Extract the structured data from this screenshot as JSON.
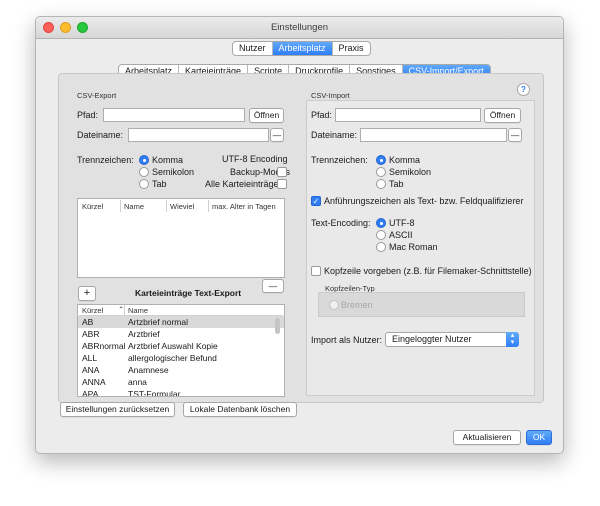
{
  "window": {
    "title": "Einstellungen"
  },
  "main_tabs": [
    {
      "label": "Nutzer"
    },
    {
      "label": "Arbeitsplatz",
      "selected": true
    },
    {
      "label": "Praxis"
    }
  ],
  "sub_tabs": [
    {
      "label": "Arbeitsplatz"
    },
    {
      "label": "Karteieinträge"
    },
    {
      "label": "Scripte"
    },
    {
      "label": "Druckprofile"
    },
    {
      "label": "Sonstiges"
    },
    {
      "label": "CSV-Import/Export",
      "selected": true
    }
  ],
  "help_button": "?",
  "export": {
    "section_title": "CSV-Export",
    "path_label": "Pfad:",
    "path_value": "",
    "open_button": "Öffnen",
    "filename_label": "Dateiname:",
    "filename_value": "",
    "filename_minus": "—",
    "separator_label": "Trennzeichen:",
    "separators": [
      {
        "label": "Komma",
        "checked": true
      },
      {
        "label": "Semikolon",
        "checked": false
      },
      {
        "label": "Tab",
        "checked": false
      }
    ],
    "encoding_label": "UTF-8 Encoding",
    "backup_label": "Backup-Modus",
    "all_entries_label": "Alle Karteieinträge",
    "table_headers": [
      "Kürzel",
      "Name",
      "Wieviel",
      "max. Alter in Tagen"
    ],
    "minus_button": "—",
    "plus_button": "+",
    "list_title": "Karteieinträge Text-Export",
    "list_headers": [
      "Kürzel",
      "Name"
    ],
    "list_rows": [
      {
        "code": "AB",
        "name": "Artzbrief normal"
      },
      {
        "code": "ABR",
        "name": "Arztbrief"
      },
      {
        "code": "ABRnormal",
        "name": "Arztbrief Auswahl Kopie"
      },
      {
        "code": "ALL",
        "name": "allergologischer Befund"
      },
      {
        "code": "ANA",
        "name": "Anamnese"
      },
      {
        "code": "ANNA",
        "name": "anna"
      },
      {
        "code": "APA",
        "name": "TST-Formular"
      }
    ]
  },
  "import": {
    "section_title": "CSV-Import",
    "path_label": "Pfad:",
    "path_value": "",
    "open_button": "Öffnen",
    "filename_label": "Dateiname:",
    "filename_value": "",
    "filename_minus": "—",
    "separator_label": "Trennzeichen:",
    "separators": [
      {
        "label": "Komma",
        "checked": true
      },
      {
        "label": "Semikolon",
        "checked": false
      },
      {
        "label": "Tab",
        "checked": false
      }
    ],
    "quote_label": "Anführungszeichen als Text- bzw. Feldqualifizierer",
    "quote_checked": true,
    "encoding_label": "Text-Encoding:",
    "encodings": [
      {
        "label": "UTF-8",
        "checked": true
      },
      {
        "label": "ASCII",
        "checked": false
      },
      {
        "label": "Mac Roman",
        "checked": false
      }
    ],
    "header_label": "Kopfzeile vorgeben (z.B. für Filemaker-Schnittstelle)",
    "header_checked": false,
    "header_type_label": "Kopfzeilen-Typ",
    "header_type_option": "Bremen",
    "import_as_label": "Import als Nutzer:",
    "import_as_value": "Eingeloggter Nutzer"
  },
  "footer": {
    "reset_button": "Einstellungen zurücksetzen",
    "delete_db_button": "Lokale Datenbank löschen",
    "update_button": "Aktualisieren",
    "ok_button": "OK"
  }
}
